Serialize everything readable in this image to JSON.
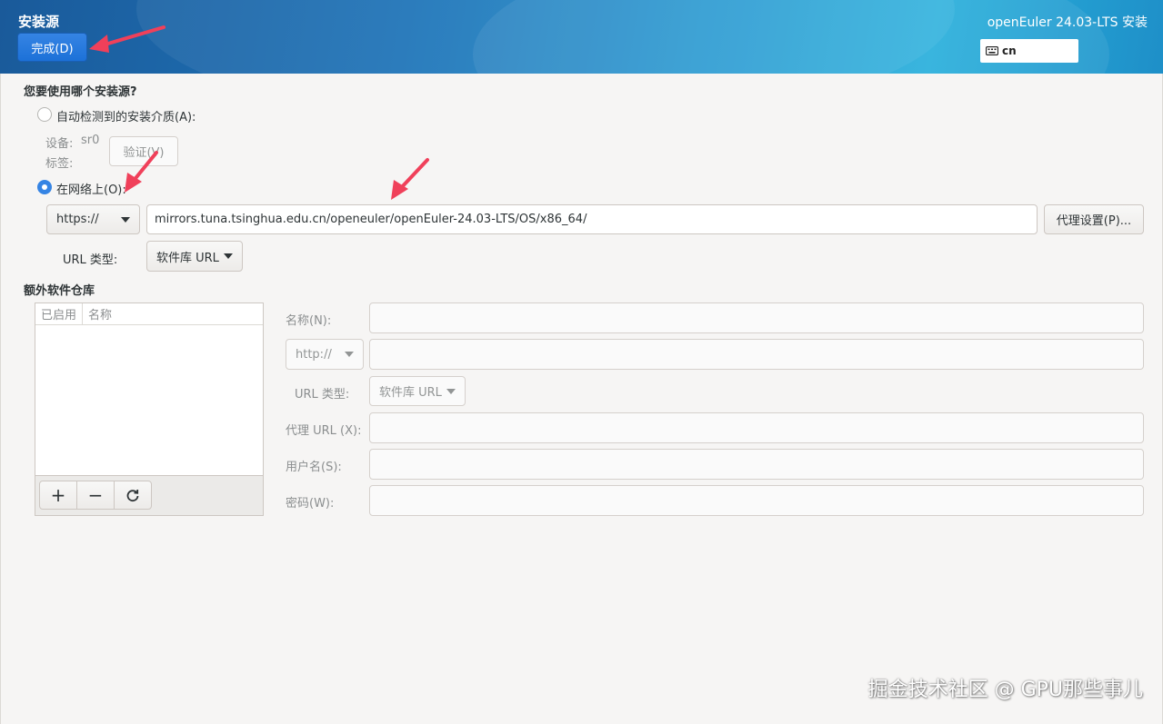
{
  "header": {
    "title": "安装源",
    "done_label": "完成(D)",
    "product": "openEuler 24.03-LTS 安装",
    "keyboard_layout": "cn"
  },
  "main": {
    "question": "您要使用哪个安装源?",
    "auto_detect": {
      "label": "自动检测到的安装介质(A):",
      "selected": false,
      "device_label": "设备:",
      "device_value": "sr0",
      "tag_label": "标签:",
      "verify_label": "验证(V)"
    },
    "network": {
      "label": "在网络上(O):",
      "selected": true,
      "protocol": "https://",
      "url": "mirrors.tuna.tsinghua.edu.cn/openeuler/openEuler-24.03-LTS/OS/x86_64/",
      "proxy_label": "代理设置(P)...",
      "url_type_label": "URL 类型:",
      "url_type_value": "软件库 URL"
    }
  },
  "extra_repos": {
    "title": "额外软件仓库",
    "col_enabled": "已启用",
    "col_name": "名称",
    "add_symbol": "+",
    "remove_symbol": "−",
    "form": {
      "name_label": "名称(N):",
      "protocol": "http://",
      "url_type_label": "URL 类型:",
      "url_type_value": "软件库 URL",
      "proxy_label": "代理 URL (X):",
      "user_label": "用户名(S):",
      "password_label": "密码(W):"
    }
  },
  "watermark": "掘金技术社区 @ GPU那些事儿",
  "colors": {
    "accent": "#3584e4",
    "annotation_arrow": "#f0405a"
  }
}
